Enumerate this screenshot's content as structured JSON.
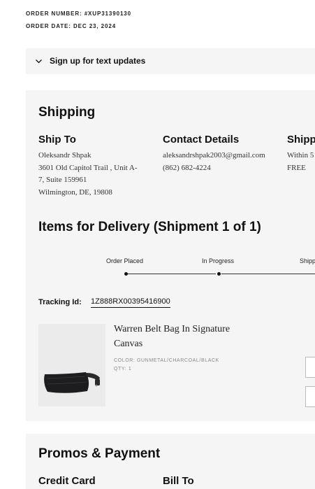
{
  "order": {
    "number_label": "ORDER NUMBER: #XUP31390130",
    "date_label": "ORDER DATE: DEC 23, 2024"
  },
  "text_updates": {
    "label": "Sign up for text updates",
    "icon": "chevron-down-icon"
  },
  "shipping": {
    "title": "Shipping",
    "ship_to": {
      "heading": "Ship To",
      "lines": [
        "Oleksandr Shpak",
        "3601 Old Capitol Trail , Unit A-",
        "7, Suite 159961",
        "Wilmington, DE, 19808"
      ]
    },
    "contact": {
      "heading": "Contact Details",
      "lines": [
        "aleksandrshpak2003@gmail.com",
        "(862) 682-4224"
      ]
    },
    "method": {
      "heading": "Shipp",
      "lines": [
        "Within 5",
        "FREE"
      ]
    }
  },
  "delivery": {
    "title": "Items for Delivery (Shipment 1 of 1)",
    "steps": [
      "Order Placed",
      "In Progress",
      "Shipp"
    ],
    "tracking_label": "Tracking Id:",
    "tracking_id": "1Z888RX00395416900"
  },
  "product": {
    "name": "Warren Belt Bag In Signature Canvas",
    "color": "COLOR: GUNMETAL/CHARCOAL/BLACK",
    "qty": "QTY: 1"
  },
  "promos": {
    "title": "Promos & Payment",
    "credit_card": "Credit Card",
    "bill_to": "Bill To"
  }
}
